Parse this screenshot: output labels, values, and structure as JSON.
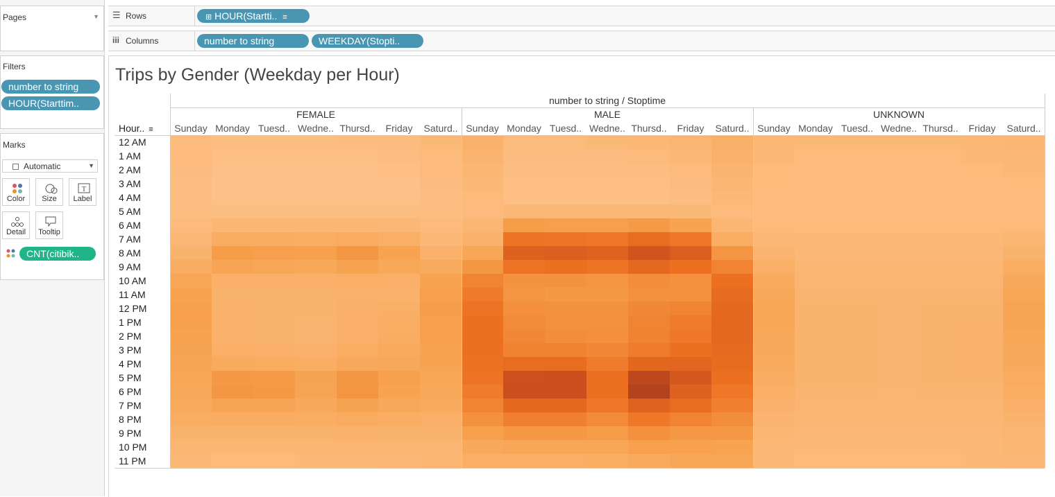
{
  "left_panel": {
    "pages_label": "Pages",
    "filters_label": "Filters",
    "filters": [
      "number to string",
      "HOUR(Starttim.."
    ],
    "marks_label": "Marks",
    "mark_type": "Automatic",
    "mark_buttons": [
      "Color",
      "Size",
      "Label",
      "Detail",
      "Tooltip"
    ],
    "mark_pill": "CNT(citibik.."
  },
  "shelves": {
    "rows_label": "Rows",
    "columns_label": "Columns",
    "rows_pills": [
      "HOUR(Startti.."
    ],
    "columns_pills": [
      "number to string",
      "WEEKDAY(Stopti.."
    ]
  },
  "view": {
    "title": "Trips by Gender (Weekday per Hour)",
    "column_group_header": "number to string / Stoptime",
    "row_header": "Hour..",
    "colors": {
      "low": "#fdbf84",
      "high": "#a13a1d",
      "border": "#cccccc",
      "pill_blue": "#4996b2",
      "pill_green": "#1fb589"
    }
  },
  "chart_data": {
    "type": "heatmap",
    "title": "Trips by Gender (Weekday per Hour)",
    "column_header": "number to string / Stoptime",
    "row_header": "Hour..",
    "genders": [
      "FEMALE",
      "MALE",
      "UNKNOWN"
    ],
    "days": [
      "Sunday",
      "Monday",
      "Tuesd..",
      "Wedne..",
      "Thursd..",
      "Friday",
      "Saturd.."
    ],
    "hours": [
      "12 AM",
      "1 AM",
      "2 AM",
      "3 AM",
      "4 AM",
      "5 AM",
      "6 AM",
      "7 AM",
      "8 AM",
      "9 AM",
      "10 AM",
      "11 AM",
      "12 PM",
      "1 PM",
      "2 PM",
      "3 PM",
      "4 PM",
      "5 PM",
      "6 PM",
      "7 PM",
      "8 PM",
      "9 PM",
      "10 PM",
      "11 PM"
    ],
    "value_scale": "relative intensity 0-1 (estimated from color)",
    "matrices": {
      "FEMALE": [
        [
          0.06,
          0.03,
          0.03,
          0.03,
          0.04,
          0.04,
          0.07
        ],
        [
          0.05,
          0.02,
          0.02,
          0.02,
          0.02,
          0.03,
          0.06
        ],
        [
          0.04,
          0.01,
          0.01,
          0.01,
          0.01,
          0.02,
          0.05
        ],
        [
          0.03,
          0.01,
          0.01,
          0.01,
          0.01,
          0.01,
          0.04
        ],
        [
          0.03,
          0.01,
          0.01,
          0.01,
          0.01,
          0.01,
          0.03
        ],
        [
          0.03,
          0.03,
          0.03,
          0.03,
          0.03,
          0.03,
          0.03
        ],
        [
          0.05,
          0.09,
          0.09,
          0.09,
          0.09,
          0.08,
          0.05
        ],
        [
          0.08,
          0.17,
          0.17,
          0.16,
          0.18,
          0.15,
          0.08
        ],
        [
          0.12,
          0.28,
          0.27,
          0.26,
          0.31,
          0.25,
          0.13
        ],
        [
          0.17,
          0.23,
          0.22,
          0.21,
          0.24,
          0.21,
          0.19
        ],
        [
          0.22,
          0.14,
          0.14,
          0.14,
          0.15,
          0.14,
          0.25
        ],
        [
          0.25,
          0.12,
          0.12,
          0.12,
          0.13,
          0.13,
          0.27
        ],
        [
          0.26,
          0.13,
          0.12,
          0.12,
          0.14,
          0.15,
          0.28
        ],
        [
          0.26,
          0.13,
          0.12,
          0.11,
          0.14,
          0.16,
          0.27
        ],
        [
          0.25,
          0.13,
          0.12,
          0.11,
          0.14,
          0.17,
          0.26
        ],
        [
          0.24,
          0.15,
          0.14,
          0.13,
          0.16,
          0.19,
          0.25
        ],
        [
          0.23,
          0.19,
          0.18,
          0.16,
          0.2,
          0.21,
          0.24
        ],
        [
          0.22,
          0.3,
          0.29,
          0.24,
          0.31,
          0.26,
          0.22
        ],
        [
          0.21,
          0.31,
          0.3,
          0.23,
          0.32,
          0.25,
          0.21
        ],
        [
          0.19,
          0.23,
          0.23,
          0.2,
          0.24,
          0.21,
          0.19
        ],
        [
          0.16,
          0.17,
          0.17,
          0.16,
          0.18,
          0.16,
          0.15
        ],
        [
          0.12,
          0.12,
          0.12,
          0.12,
          0.13,
          0.12,
          0.12
        ],
        [
          0.09,
          0.09,
          0.09,
          0.09,
          0.1,
          0.1,
          0.1
        ],
        [
          0.07,
          0.06,
          0.06,
          0.07,
          0.07,
          0.08,
          0.09
        ]
      ],
      "MALE": [
        [
          0.13,
          0.06,
          0.06,
          0.07,
          0.08,
          0.1,
          0.15
        ],
        [
          0.11,
          0.04,
          0.04,
          0.04,
          0.05,
          0.07,
          0.13
        ],
        [
          0.09,
          0.03,
          0.03,
          0.03,
          0.03,
          0.05,
          0.11
        ],
        [
          0.07,
          0.02,
          0.02,
          0.02,
          0.02,
          0.04,
          0.09
        ],
        [
          0.06,
          0.02,
          0.02,
          0.02,
          0.02,
          0.03,
          0.07
        ],
        [
          0.05,
          0.08,
          0.08,
          0.08,
          0.08,
          0.07,
          0.05
        ],
        [
          0.09,
          0.28,
          0.27,
          0.27,
          0.29,
          0.25,
          0.09
        ],
        [
          0.13,
          0.48,
          0.47,
          0.46,
          0.52,
          0.46,
          0.16
        ],
        [
          0.22,
          0.62,
          0.63,
          0.6,
          0.72,
          0.64,
          0.32
        ],
        [
          0.31,
          0.48,
          0.5,
          0.48,
          0.56,
          0.5,
          0.4
        ],
        [
          0.4,
          0.33,
          0.33,
          0.32,
          0.36,
          0.34,
          0.5
        ],
        [
          0.45,
          0.32,
          0.3,
          0.3,
          0.34,
          0.34,
          0.54
        ],
        [
          0.48,
          0.35,
          0.33,
          0.33,
          0.38,
          0.4,
          0.56
        ],
        [
          0.5,
          0.37,
          0.34,
          0.34,
          0.4,
          0.44,
          0.56
        ],
        [
          0.5,
          0.38,
          0.36,
          0.35,
          0.41,
          0.46,
          0.56
        ],
        [
          0.5,
          0.41,
          0.41,
          0.38,
          0.44,
          0.5,
          0.55
        ],
        [
          0.49,
          0.52,
          0.52,
          0.44,
          0.57,
          0.58,
          0.53
        ],
        [
          0.48,
          0.75,
          0.76,
          0.5,
          0.84,
          0.68,
          0.5
        ],
        [
          0.44,
          0.76,
          0.76,
          0.5,
          0.9,
          0.62,
          0.46
        ],
        [
          0.4,
          0.56,
          0.56,
          0.46,
          0.6,
          0.52,
          0.42
        ],
        [
          0.34,
          0.42,
          0.42,
          0.37,
          0.46,
          0.4,
          0.36
        ],
        [
          0.26,
          0.3,
          0.3,
          0.28,
          0.34,
          0.3,
          0.3
        ],
        [
          0.2,
          0.22,
          0.22,
          0.22,
          0.26,
          0.26,
          0.25
        ],
        [
          0.15,
          0.15,
          0.15,
          0.16,
          0.19,
          0.22,
          0.22
        ]
      ],
      "UNKNOWN": [
        [
          0.08,
          0.07,
          0.07,
          0.07,
          0.07,
          0.08,
          0.09
        ],
        [
          0.07,
          0.06,
          0.06,
          0.06,
          0.06,
          0.07,
          0.08
        ],
        [
          0.06,
          0.05,
          0.05,
          0.05,
          0.05,
          0.06,
          0.07
        ],
        [
          0.06,
          0.05,
          0.05,
          0.05,
          0.05,
          0.05,
          0.06
        ],
        [
          0.05,
          0.05,
          0.05,
          0.05,
          0.05,
          0.05,
          0.05
        ],
        [
          0.05,
          0.05,
          0.05,
          0.05,
          0.05,
          0.05,
          0.05
        ],
        [
          0.06,
          0.06,
          0.06,
          0.06,
          0.06,
          0.06,
          0.06
        ],
        [
          0.08,
          0.07,
          0.07,
          0.07,
          0.07,
          0.07,
          0.09
        ],
        [
          0.11,
          0.08,
          0.08,
          0.08,
          0.08,
          0.08,
          0.12
        ],
        [
          0.15,
          0.09,
          0.09,
          0.09,
          0.09,
          0.09,
          0.16
        ],
        [
          0.19,
          0.1,
          0.1,
          0.1,
          0.1,
          0.1,
          0.2
        ],
        [
          0.21,
          0.11,
          0.11,
          0.11,
          0.11,
          0.11,
          0.22
        ],
        [
          0.22,
          0.12,
          0.12,
          0.11,
          0.12,
          0.12,
          0.23
        ],
        [
          0.22,
          0.12,
          0.12,
          0.11,
          0.12,
          0.12,
          0.23
        ],
        [
          0.21,
          0.12,
          0.12,
          0.11,
          0.12,
          0.13,
          0.22
        ],
        [
          0.2,
          0.12,
          0.12,
          0.11,
          0.12,
          0.13,
          0.21
        ],
        [
          0.19,
          0.12,
          0.12,
          0.11,
          0.12,
          0.13,
          0.2
        ],
        [
          0.17,
          0.12,
          0.12,
          0.11,
          0.12,
          0.12,
          0.18
        ],
        [
          0.15,
          0.11,
          0.11,
          0.1,
          0.11,
          0.11,
          0.16
        ],
        [
          0.13,
          0.1,
          0.1,
          0.1,
          0.1,
          0.1,
          0.14
        ],
        [
          0.11,
          0.09,
          0.09,
          0.09,
          0.09,
          0.09,
          0.12
        ],
        [
          0.09,
          0.08,
          0.08,
          0.08,
          0.08,
          0.08,
          0.1
        ],
        [
          0.08,
          0.07,
          0.07,
          0.07,
          0.07,
          0.07,
          0.09
        ],
        [
          0.07,
          0.06,
          0.06,
          0.06,
          0.06,
          0.07,
          0.08
        ]
      ]
    }
  }
}
